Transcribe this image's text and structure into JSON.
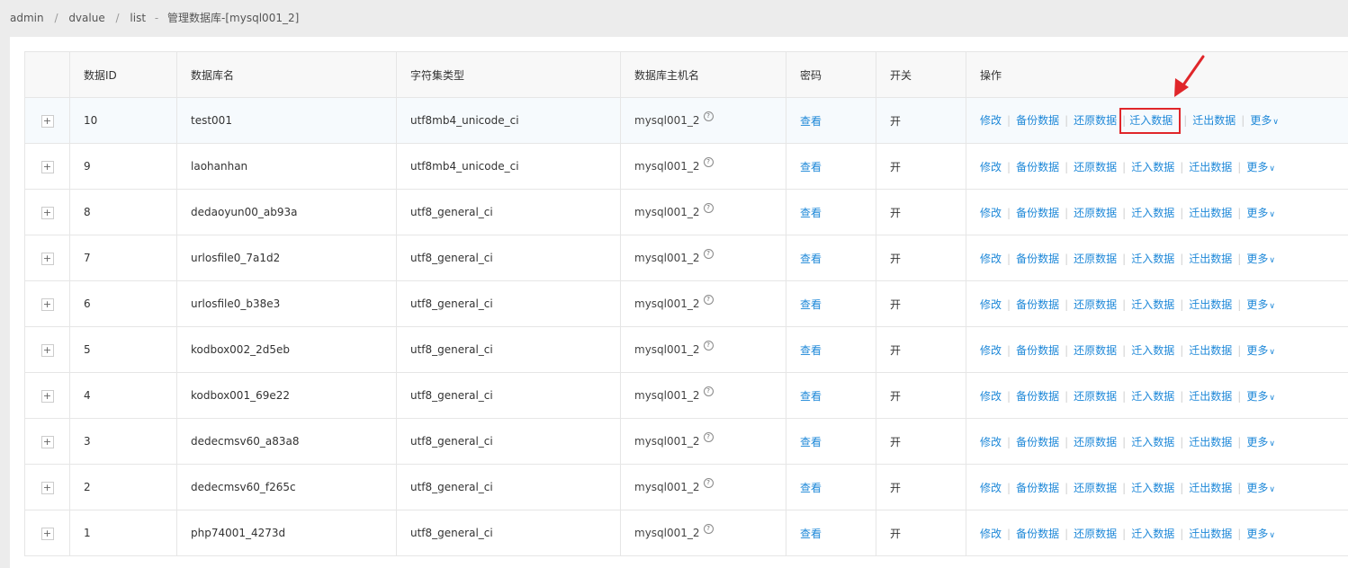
{
  "breadcrumb": {
    "items": [
      "admin",
      "dvalue",
      "list"
    ],
    "title": "管理数据库-[mysql001_2]",
    "separator": "/",
    "dash": "-"
  },
  "table": {
    "headers": {
      "id": "数据ID",
      "name": "数据库名",
      "charset": "字符集类型",
      "host": "数据库主机名",
      "password": "密码",
      "switch": "开关",
      "actions": "操作"
    },
    "expand_symbol": "+",
    "help_symbol": "?",
    "password_link": "查看",
    "switch_value": "开",
    "actions": {
      "edit": "修改",
      "backup": "备份数据",
      "restore": "还原数据",
      "import": "迁入数据",
      "export": "迁出数据",
      "more": "更多"
    },
    "rows": [
      {
        "id": "10",
        "name": "test001",
        "charset": "utf8mb4_unicode_ci",
        "host": "mysql001_2"
      },
      {
        "id": "9",
        "name": "laohanhan",
        "charset": "utf8mb4_unicode_ci",
        "host": "mysql001_2"
      },
      {
        "id": "8",
        "name": "dedaoyun00_ab93a",
        "charset": "utf8_general_ci",
        "host": "mysql001_2"
      },
      {
        "id": "7",
        "name": "urlosfile0_7a1d2",
        "charset": "utf8_general_ci",
        "host": "mysql001_2"
      },
      {
        "id": "6",
        "name": "urlosfile0_b38e3",
        "charset": "utf8_general_ci",
        "host": "mysql001_2"
      },
      {
        "id": "5",
        "name": "kodbox002_2d5eb",
        "charset": "utf8_general_ci",
        "host": "mysql001_2"
      },
      {
        "id": "4",
        "name": "kodbox001_69e22",
        "charset": "utf8_general_ci",
        "host": "mysql001_2"
      },
      {
        "id": "3",
        "name": "dedecmsv60_a83a8",
        "charset": "utf8_general_ci",
        "host": "mysql001_2"
      },
      {
        "id": "2",
        "name": "dedecmsv60_f265c",
        "charset": "utf8_general_ci",
        "host": "mysql001_2"
      },
      {
        "id": "1",
        "name": "php74001_4273d",
        "charset": "utf8_general_ci",
        "host": "mysql001_2"
      }
    ]
  },
  "colors": {
    "link": "#1e88d8",
    "highlight_box": "#e0262a",
    "annotation_arrow": "#e0262a"
  }
}
